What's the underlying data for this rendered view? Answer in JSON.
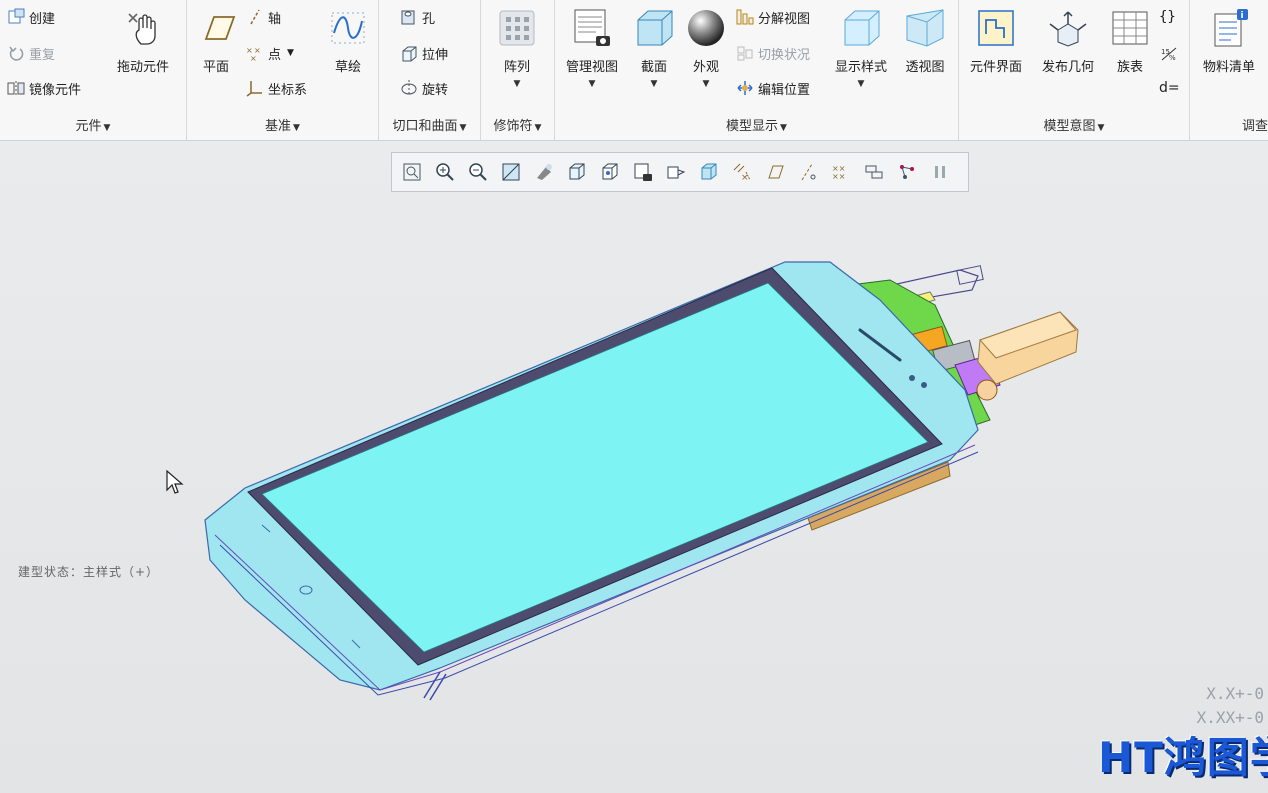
{
  "ribbon": {
    "groups": {
      "component": {
        "label": "元件",
        "create": "创建",
        "repeat": "重复",
        "mirror": "镜像元件",
        "drag": "拖动元件"
      },
      "datum": {
        "label": "基准",
        "plane": "平面",
        "axis": "轴",
        "point": "点",
        "csys": "坐标系",
        "sketch": "草绘"
      },
      "cut": {
        "label": "切口和曲面",
        "hole": "孔",
        "extrude": "拉伸",
        "revolve": "旋转"
      },
      "modifier": {
        "label": "修饰符",
        "pattern": "阵列"
      },
      "display": {
        "label": "模型显示",
        "manage_views": "管理视图",
        "section": "截面",
        "appearance": "外观",
        "explode": "分解视图",
        "toggle_state": "切换状况",
        "edit_position": "编辑位置",
        "display_style": "显示样式",
        "perspective": "透视图"
      },
      "intent": {
        "label": "模型意图",
        "component_interface": "元件界面",
        "publish_geometry": "发布几何",
        "family_table": "族表",
        "braces": "{}",
        "d_equals": "d="
      },
      "investigate": {
        "label": "调查",
        "bom": "物料清单"
      }
    }
  },
  "viewport": {
    "model_state": "建型状态：主样式（+）",
    "tolerance1": "X.X+-0",
    "tolerance2": "X.XX+-0",
    "logo_text": "HT鸿图学"
  },
  "colors": {
    "screen": "#7ef3f3",
    "bezel": "#4a4a6a",
    "body": "#8ee0ef",
    "accent": "#1a58d6"
  }
}
